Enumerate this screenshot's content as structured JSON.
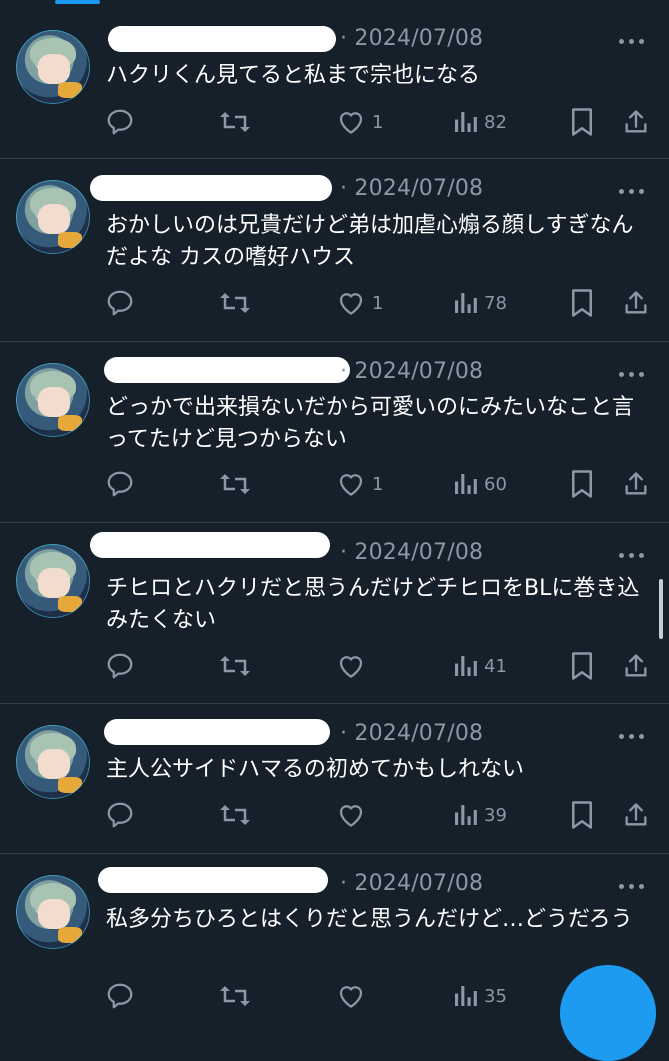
{
  "tweets": [
    {
      "date": "2024/07/08",
      "text": "ハクリくん見てると私まで宗也になる",
      "reply_count": "",
      "repost_count": "",
      "like_count": "1",
      "view_count": "82"
    },
    {
      "date": "2024/07/08",
      "text": "おかしいのは兄貴だけど弟は加虐心煽る顔しすぎなんだよな カスの嗜好ハウス",
      "reply_count": "",
      "repost_count": "",
      "like_count": "1",
      "view_count": "78"
    },
    {
      "date": "2024/07/08",
      "text": "どっかで出来損ないだから可愛いのにみたいなこと言ってたけど見つからない",
      "reply_count": "",
      "repost_count": "",
      "like_count": "1",
      "view_count": "60"
    },
    {
      "date": "2024/07/08",
      "text": "チヒロとハクリだと思うんだけどチヒロをBLに巻き込みたくない",
      "reply_count": "",
      "repost_count": "",
      "like_count": "",
      "view_count": "41"
    },
    {
      "date": "2024/07/08",
      "text": "主人公サイドハマるの初めてかもしれない",
      "reply_count": "",
      "repost_count": "",
      "like_count": "",
      "view_count": "39"
    },
    {
      "date": "2024/07/08",
      "text": "私多分ちひろとはくりだと思うんだけど…どうだろう",
      "reply_count": "",
      "repost_count": "",
      "like_count": "",
      "view_count": "35"
    }
  ],
  "separator": "·",
  "icons": {
    "reply": "reply-icon",
    "repost": "repost-icon",
    "like": "heart-icon",
    "views": "views-icon",
    "bookmark": "bookmark-icon",
    "share": "share-icon",
    "more": "more-icon"
  },
  "colors": {
    "background": "#15202b",
    "muted": "#8b98a5",
    "accent": "#1d9bf0"
  }
}
